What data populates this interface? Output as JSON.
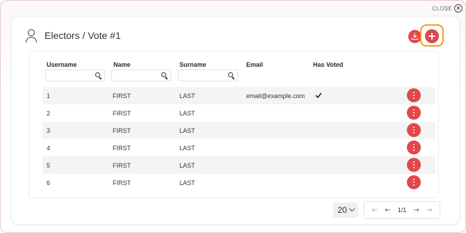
{
  "window": {
    "close_label": "CLOSE"
  },
  "header": {
    "title": "Electors / Vote #1",
    "icon": "user-icon"
  },
  "actions": {
    "download_icon": "download-icon",
    "add_icon": "plus-icon",
    "accent": "#e0484b",
    "highlight": "#f39c1d"
  },
  "table": {
    "columns": [
      "Username",
      "Name",
      "Surname",
      "Email",
      "Has Voted"
    ],
    "filter_placeholder": "",
    "rows": [
      {
        "username": "1",
        "name": "FIRST",
        "surname": "LAST",
        "email": "email@example.com",
        "has_voted": true
      },
      {
        "username": "2",
        "name": "FIRST",
        "surname": "LAST",
        "email": "",
        "has_voted": false
      },
      {
        "username": "3",
        "name": "FIRST",
        "surname": "LAST",
        "email": "",
        "has_voted": false
      },
      {
        "username": "4",
        "name": "FIRST",
        "surname": "LAST",
        "email": "",
        "has_voted": false
      },
      {
        "username": "5",
        "name": "FIRST",
        "surname": "LAST",
        "email": "",
        "has_voted": false
      },
      {
        "username": "6",
        "name": "FIRST",
        "surname": "LAST",
        "email": "",
        "has_voted": false
      }
    ]
  },
  "pagination": {
    "page_size": "20",
    "page_indicator": "1/1"
  }
}
